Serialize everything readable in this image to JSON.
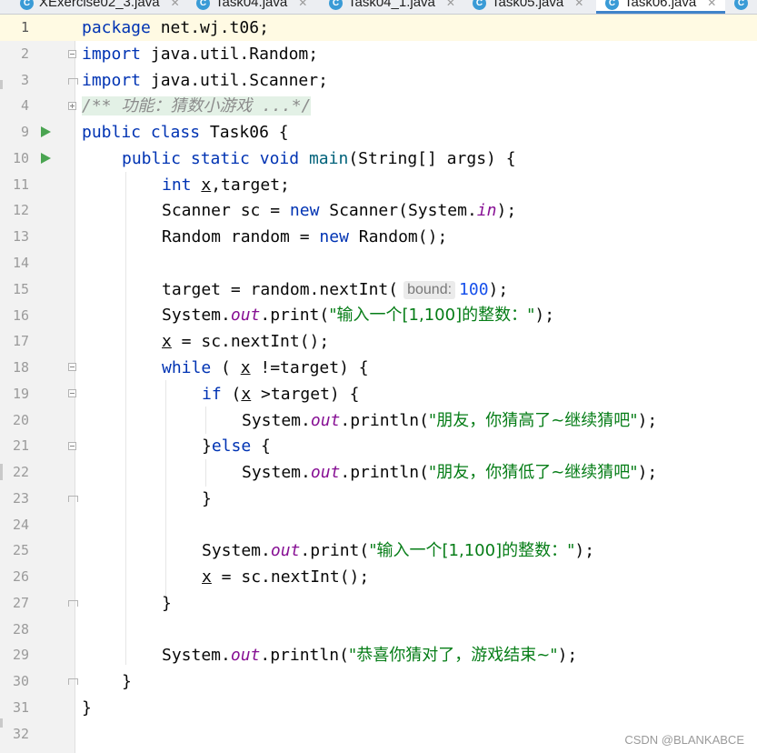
{
  "tabs": [
    {
      "label": "XExercise02_3.java",
      "active": false
    },
    {
      "label": "Task04.java",
      "active": false
    },
    {
      "label": "Task04_1.java",
      "active": false
    },
    {
      "label": "Task05.java",
      "active": false
    },
    {
      "label": "Task06.java",
      "active": true
    }
  ],
  "gutter": {
    "line_numbers": [
      "1",
      "2",
      "3",
      "4",
      "9",
      "10",
      "11",
      "12",
      "13",
      "14",
      "15",
      "16",
      "17",
      "18",
      "19",
      "20",
      "21",
      "22",
      "23",
      "24",
      "25",
      "26",
      "27",
      "28",
      "29",
      "30",
      "31",
      "32"
    ],
    "current_line": "1",
    "run_lines": [
      "9",
      "10"
    ],
    "run_icon": "run-gutter-icon",
    "fold_icon": "fold-icon"
  },
  "code": {
    "line1": {
      "kw": "package",
      "rest": " net.wj.t06;"
    },
    "line2": {
      "kw": "import",
      "rest": " java.util.Random;"
    },
    "line3": {
      "kw": "import",
      "rest": " java.util.Scanner;"
    },
    "line4": {
      "comment": "/** 功能：猜数小游戏 ...*/"
    },
    "line9": {
      "kw1": "public",
      "kw2": "class",
      "rest": " Task06 {"
    },
    "line10": {
      "kw1": "public",
      "kw2": "static",
      "kw3": "void",
      "method": "main",
      "rest": "(String[] args) {"
    },
    "line11": {
      "kw": "int",
      "var": "x",
      "rest": ",target;"
    },
    "line12": {
      "pre": "Scanner sc = ",
      "kw": "new",
      "mid": " Scanner(System.",
      "field": "in",
      "post": ");"
    },
    "line13": {
      "pre": "Random random = ",
      "kw": "new",
      "post": " Random();"
    },
    "line15": {
      "pre": "target = random.nextInt(",
      "hint_label": "bound:",
      "hint_value": "100",
      "post": ");"
    },
    "line16": {
      "pre": "System.",
      "field": "out",
      "mid": ".print(",
      "str": "\"输入一个[1,100]的整数：\"",
      "post": ");"
    },
    "line17": {
      "var": "x",
      "rest": " = sc.nextInt();"
    },
    "line18": {
      "kw": "while",
      "pre": " ( ",
      "var": "x",
      "post": " !=target) {"
    },
    "line19": {
      "kw": "if",
      "pre": " (",
      "var": "x",
      "post": " >target) {"
    },
    "line20": {
      "pre": "System.",
      "field": "out",
      "mid": ".println(",
      "str": "\"朋友，你猜高了~继续猜吧\"",
      "post": ");"
    },
    "line21": {
      "pre": "}",
      "kw": "else",
      "post": " {"
    },
    "line22": {
      "pre": "System.",
      "field": "out",
      "mid": ".println(",
      "str": "\"朋友，你猜低了~继续猜吧\"",
      "post": ");"
    },
    "line23": {
      "text": "}"
    },
    "line25": {
      "pre": "System.",
      "field": "out",
      "mid": ".print(",
      "str": "\"输入一个[1,100]的整数：\"",
      "post": ");"
    },
    "line26": {
      "var": "x",
      "rest": " = sc.nextInt();"
    },
    "line27": {
      "text": "}"
    },
    "line29": {
      "pre": "System.",
      "field": "out",
      "mid": ".println(",
      "str": "\"恭喜你猜对了，游戏结束~\"",
      "post": ");"
    },
    "line30": {
      "text": "}"
    },
    "line31": {
      "text": "}"
    }
  },
  "watermark": "CSDN @BLANKABCE",
  "colors": {
    "keyword": "#0033b3",
    "string": "#067d17",
    "number": "#1750eb",
    "static_field": "#871094",
    "method_decl": "#00627a",
    "run_icon": "#4aa451",
    "active_tab_underline": "#4083c9"
  }
}
